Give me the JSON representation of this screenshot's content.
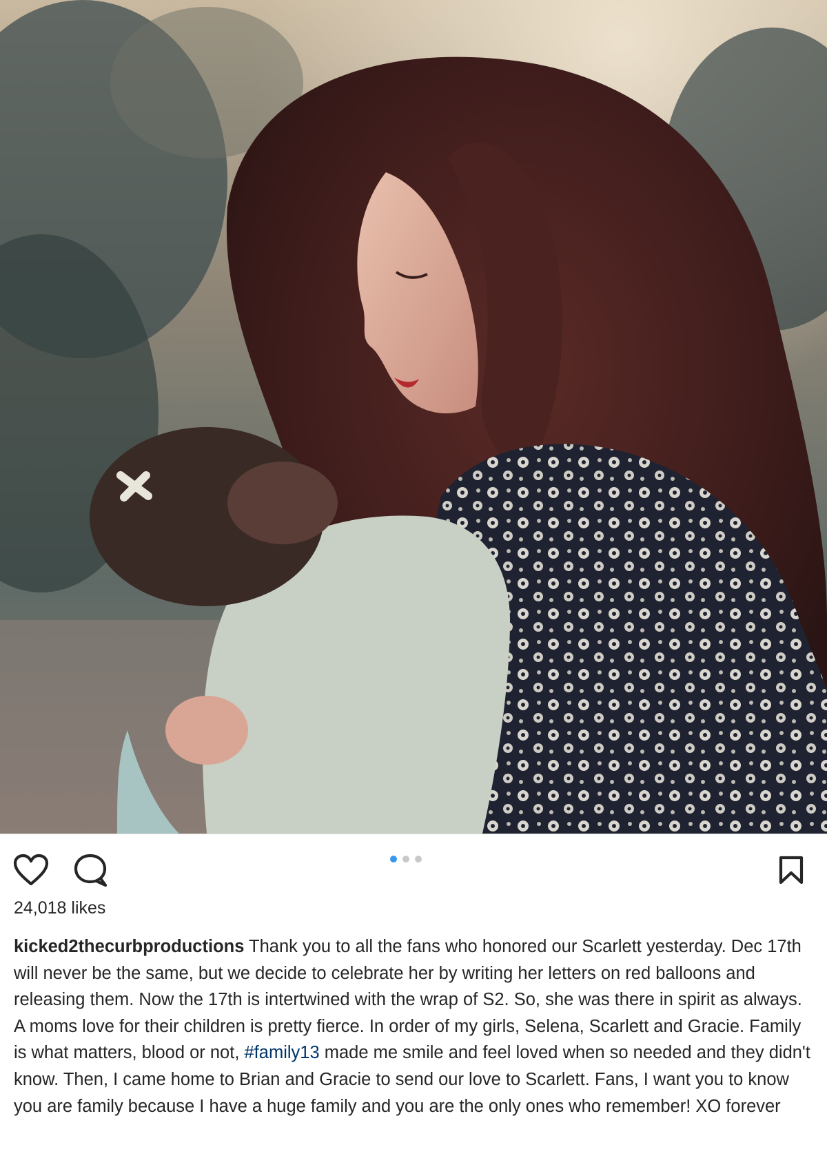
{
  "post": {
    "likes_text": "24,018 likes",
    "username": "kicked2thecurbproductions",
    "caption_part1": " Thank you to all the fans who honored our Scarlett yesterday. Dec 17th will never be the same, but we decide to celebrate her by writing her letters on red balloons and releasing them. Now the 17th is intertwined with the wrap of S2. So, she was there in spirit as always. A moms love for their children is pretty fierce. In order of my girls, Selena, Scarlett and Gracie. Family is what matters, blood or not, ",
    "hashtag": "#family13",
    "caption_part2": " made me smile and feel loved when so needed and they didn't know. Then, I came home to Brian and Gracie to send our love to Scarlett. Fans, I want you to know you are family because I have a huge family and you are the only ones who remember! XO forever"
  },
  "carousel": {
    "count": 3,
    "active_index": 0
  },
  "icons": {
    "like": "heart-icon",
    "comment": "comment-icon",
    "save": "bookmark-icon"
  },
  "colors": {
    "accent": "#3897f0",
    "hashtag": "#003569",
    "text": "#262626",
    "divider": "#dbdbdb"
  }
}
